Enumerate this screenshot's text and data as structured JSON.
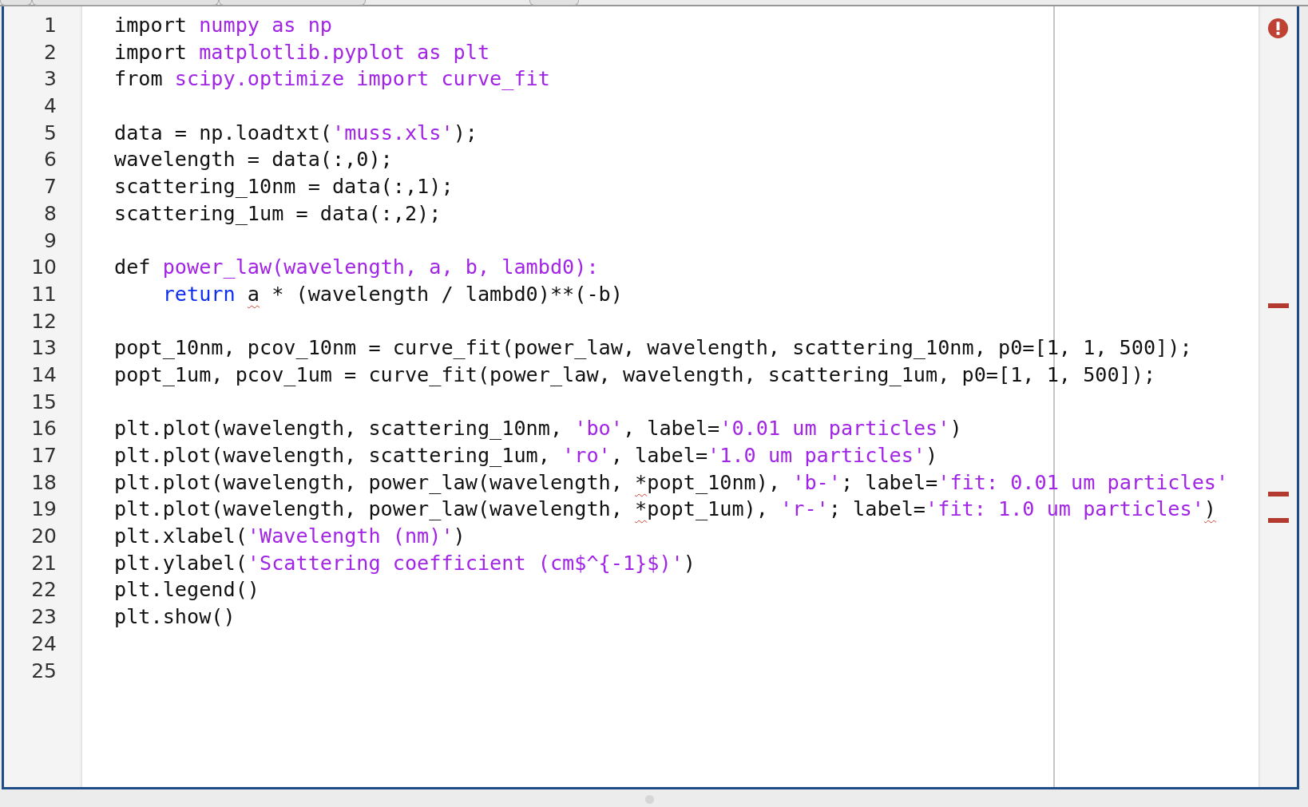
{
  "editor": {
    "lines": [
      {
        "number": "1",
        "error": false,
        "tokens": [
          {
            "text": "import ",
            "kind": "plain"
          },
          {
            "text": "numpy as np",
            "kind": "literal"
          }
        ]
      },
      {
        "number": "2",
        "error": false,
        "tokens": [
          {
            "text": "import ",
            "kind": "plain"
          },
          {
            "text": "matplotlib.pyplot as plt",
            "kind": "literal"
          }
        ]
      },
      {
        "number": "3",
        "error": false,
        "tokens": [
          {
            "text": "from ",
            "kind": "plain"
          },
          {
            "text": "scipy.optimize import curve_fit",
            "kind": "literal"
          }
        ]
      },
      {
        "number": "4",
        "error": false
      },
      {
        "number": "5",
        "error": false,
        "tokens": [
          {
            "text": "data = np.loadtxt(",
            "kind": "plain"
          },
          {
            "text": "'muss.xls'",
            "kind": "literal"
          },
          {
            "text": ");",
            "kind": "plain"
          }
        ]
      },
      {
        "number": "6",
        "error": false,
        "tokens": [
          {
            "text": "wavelength = data(:,0);",
            "kind": "plain"
          }
        ]
      },
      {
        "number": "7",
        "error": false,
        "tokens": [
          {
            "text": "scattering_10nm = data(:,1);",
            "kind": "plain"
          }
        ]
      },
      {
        "number": "8",
        "error": false,
        "tokens": [
          {
            "text": "scattering_1um = data(:,2);",
            "kind": "plain"
          }
        ]
      },
      {
        "number": "9",
        "error": false
      },
      {
        "number": "10",
        "error": false,
        "tokens": [
          {
            "text": "def ",
            "kind": "plain"
          },
          {
            "text": "power_law(wavelength, a, b, lambd0):",
            "kind": "literal"
          }
        ],
        "children": [
          {
            "number": "11",
            "error": true,
            "tokens": [
              {
                "text": "return ",
                "kind": "keyword"
              },
              {
                "text": "a",
                "kind": "flagged"
              },
              {
                "text": " * (wavelength / lambd0)**(-b)",
                "kind": "plain"
              }
            ]
          }
        ]
      },
      {
        "number": "12",
        "error": false
      },
      {
        "number": "13",
        "error": false,
        "tokens": [
          {
            "text": "popt_10nm, pcov_10nm = curve_fit(power_law, wavelength, scattering_10nm, p0=[1, 1, 500]);",
            "kind": "plain"
          }
        ]
      },
      {
        "number": "14",
        "error": false,
        "tokens": [
          {
            "text": "popt_1um, pcov_1um = curve_fit(power_law, wavelength, scattering_1um, p0=[1, 1, 500]);",
            "kind": "plain"
          }
        ]
      },
      {
        "number": "15",
        "error": false
      },
      {
        "number": "16",
        "error": false,
        "tokens": [
          {
            "text": "plt.plot(wavelength, scattering_10nm, ",
            "kind": "plain"
          },
          {
            "text": "'bo'",
            "kind": "literal"
          },
          {
            "text": ", label=",
            "kind": "plain"
          },
          {
            "text": "'0.01 um particles'",
            "kind": "literal"
          },
          {
            "text": ")",
            "kind": "plain"
          }
        ]
      },
      {
        "number": "17",
        "error": false,
        "tokens": [
          {
            "text": "plt.plot(wavelength, scattering_1um, ",
            "kind": "plain"
          },
          {
            "text": "'ro'",
            "kind": "literal"
          },
          {
            "text": ", label=",
            "kind": "plain"
          },
          {
            "text": "'1.0 um particles'",
            "kind": "literal"
          },
          {
            "text": ")",
            "kind": "plain"
          }
        ]
      },
      {
        "number": "18",
        "error": true,
        "tokens": [
          {
            "text": "plt.plot(wavelength, power_law(wavelength, ",
            "kind": "plain"
          },
          {
            "text": "*",
            "kind": "flagged"
          },
          {
            "text": "popt_10nm), ",
            "kind": "plain"
          },
          {
            "text": "'b-'",
            "kind": "literal"
          },
          {
            "text": "; label=",
            "kind": "plain"
          },
          {
            "text": "'fit: 0.01 um particles'",
            "kind": "literal"
          }
        ]
      },
      {
        "number": "19",
        "error": true,
        "tokens": [
          {
            "text": "plt.plot(wavelength, power_law(wavelength, ",
            "kind": "plain"
          },
          {
            "text": "*",
            "kind": "flagged"
          },
          {
            "text": "popt_1um), ",
            "kind": "plain"
          },
          {
            "text": "'r-'",
            "kind": "literal"
          },
          {
            "text": "; label=",
            "kind": "plain"
          },
          {
            "text": "'fit: 1.0 um particles'",
            "kind": "literal"
          },
          {
            "text": ")",
            "kind": "flagged"
          }
        ]
      },
      {
        "number": "20",
        "error": false,
        "tokens": [
          {
            "text": "plt.xlabel(",
            "kind": "plain"
          },
          {
            "text": "'Wavelength (nm)'",
            "kind": "literal"
          },
          {
            "text": ")",
            "kind": "plain"
          }
        ]
      },
      {
        "number": "21",
        "error": false,
        "tokens": [
          {
            "text": "plt.ylabel(",
            "kind": "plain"
          },
          {
            "text": "'Scattering coefficient (cm$^{-1}",
            "kind": "literal"
          },
          {
            "text": "$)'",
            "kind": "literal"
          },
          {
            "text": ")",
            "kind": "plain"
          }
        ]
      },
      {
        "number": "22",
        "error": false,
        "tokens": [
          {
            "text": "plt.legend()",
            "kind": "plain"
          }
        ]
      },
      {
        "number": "23",
        "error": false,
        "tokens": [
          {
            "text": "plt.show()",
            "kind": "plain"
          }
        ]
      },
      {
        "number": "24",
        "error": false
      },
      {
        "number": "25",
        "error": false
      }
    ]
  }
}
